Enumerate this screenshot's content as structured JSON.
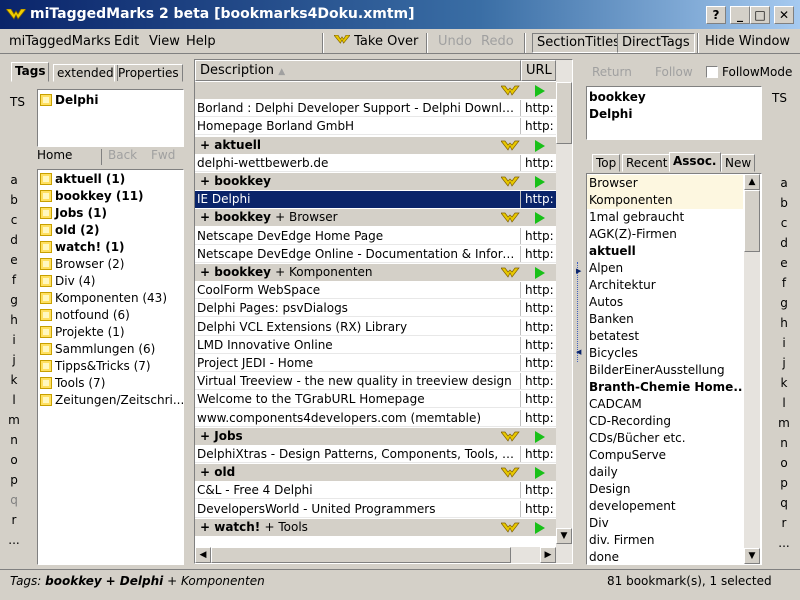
{
  "window": {
    "title": "miTaggedMarks 2 beta [bookmarks4Doku.xmtm]",
    "caption_buttons": [
      "?",
      "_",
      "□",
      "✕"
    ]
  },
  "menubar": {
    "items": [
      "miTaggedMarks",
      "Edit",
      "View",
      "Help"
    ],
    "take_over": "Take Over",
    "undo": "Undo",
    "redo": "Redo",
    "section_titles": "SectionTitles",
    "direct_tags": "DirectTags",
    "hide_window": "Hide Window"
  },
  "left": {
    "tabs": [
      "Tags",
      "extended",
      "Properties"
    ],
    "ts_label": "TS",
    "selected_tags": [
      "Delphi"
    ],
    "nav": {
      "home": "Home",
      "back": "Back",
      "fwd": "Fwd"
    },
    "letters": [
      "a",
      "b",
      "c",
      "d",
      "e",
      "f",
      "g",
      "h",
      "i",
      "j",
      "k",
      "l",
      "m",
      "n",
      "o",
      "p",
      "q",
      "r",
      "..."
    ],
    "tags": [
      {
        "label": "aktuell (1)",
        "bold": true
      },
      {
        "label": "bookkey (11)",
        "bold": true
      },
      {
        "label": "Jobs (1)",
        "bold": true
      },
      {
        "label": "old (2)",
        "bold": true
      },
      {
        "label": "watch! (1)",
        "bold": true
      },
      {
        "label": "Browser (2)",
        "bold": false
      },
      {
        "label": "Div (4)",
        "bold": false
      },
      {
        "label": "Komponenten (43)",
        "bold": false
      },
      {
        "label": "notfound (6)",
        "bold": false
      },
      {
        "label": "Projekte (1)",
        "bold": false
      },
      {
        "label": "Sammlungen (6)",
        "bold": false
      },
      {
        "label": "Tipps&Tricks (7)",
        "bold": false
      },
      {
        "label": "Tools (7)",
        "bold": false
      },
      {
        "label": "Zeitungen/Zeitschri...",
        "bold": false
      }
    ]
  },
  "grid": {
    "col_description": "Description",
    "col_url": "URL",
    "rows": [
      {
        "type": "group",
        "title": "",
        "sub": ""
      },
      {
        "type": "item",
        "desc": "Borland : Delphi Developer Support - Delphi Downloads",
        "url": "http:"
      },
      {
        "type": "item",
        "desc": "Homepage Borland GmbH",
        "url": "http:"
      },
      {
        "type": "group",
        "title": "+ aktuell",
        "sub": ""
      },
      {
        "type": "item",
        "desc": "delphi-wettbewerb.de",
        "url": "http:"
      },
      {
        "type": "group",
        "title": "+ bookkey",
        "sub": ""
      },
      {
        "type": "item",
        "desc": "IE Delphi",
        "url": "http:",
        "selected": true
      },
      {
        "type": "group",
        "title": "+ bookkey",
        "sub": "+ Browser"
      },
      {
        "type": "item",
        "desc": "Netscape DevEdge Home Page",
        "url": "http:"
      },
      {
        "type": "item",
        "desc": "Netscape DevEdge Online - Documentation & Informat...",
        "url": "http:"
      },
      {
        "type": "group",
        "title": "+ bookkey",
        "sub": "+ Komponenten"
      },
      {
        "type": "item",
        "desc": "CoolForm WebSpace",
        "url": "http:"
      },
      {
        "type": "item",
        "desc": "Delphi Pages: psvDialogs",
        "url": "http:"
      },
      {
        "type": "item",
        "desc": "Delphi VCL Extensions (RX) Library",
        "url": "http:"
      },
      {
        "type": "item",
        "desc": "LMD Innovative Online",
        "url": "http:"
      },
      {
        "type": "item",
        "desc": "Project JEDI - Home",
        "url": "http:"
      },
      {
        "type": "item",
        "desc": "Virtual Treeview - the new quality in treeview design",
        "url": "http:"
      },
      {
        "type": "item",
        "desc": "Welcome to the TGrabURL Homepage",
        "url": "http:"
      },
      {
        "type": "item",
        "desc": "www.components4developers.com (memtable)",
        "url": "http:"
      },
      {
        "type": "group",
        "title": "+ Jobs",
        "sub": ""
      },
      {
        "type": "item",
        "desc": "DelphiXtras - Design Patterns, Components, Tools, Ex...",
        "url": "http:"
      },
      {
        "type": "group",
        "title": "+ old",
        "sub": ""
      },
      {
        "type": "item",
        "desc": "C&L - Free 4 Delphi",
        "url": "http:"
      },
      {
        "type": "item",
        "desc": "DevelopersWorld - United Programmers",
        "url": "http:"
      },
      {
        "type": "group",
        "title": "+ watch!",
        "sub": "+ Tools"
      }
    ]
  },
  "right": {
    "return": "Return",
    "follow": "Follow",
    "follow_mode": "FollowMode",
    "ts_label": "TS",
    "current_tags": [
      "bookkey",
      "Delphi"
    ],
    "tabs": [
      "Top",
      "Recent",
      "Assoc.",
      "New"
    ],
    "assoc": [
      {
        "label": "Browser",
        "bold": false
      },
      {
        "label": "Komponenten",
        "bold": false
      },
      {
        "label": "1mal gebraucht",
        "bold": false
      },
      {
        "label": "AGK(Z)-Firmen",
        "bold": false
      },
      {
        "label": "aktuell",
        "bold": true
      },
      {
        "label": "Alpen",
        "bold": false
      },
      {
        "label": "Architektur",
        "bold": false
      },
      {
        "label": "Autos",
        "bold": false
      },
      {
        "label": "Banken",
        "bold": false
      },
      {
        "label": "betatest",
        "bold": false
      },
      {
        "label": "Bicycles",
        "bold": false
      },
      {
        "label": "BilderEinerAusstellung",
        "bold": false
      },
      {
        "label": "Branth-Chemie Home...",
        "bold": true
      },
      {
        "label": "CADCAM",
        "bold": false
      },
      {
        "label": "CD-Recording",
        "bold": false
      },
      {
        "label": "CDs/Bücher etc.",
        "bold": false
      },
      {
        "label": "CompuServe",
        "bold": false
      },
      {
        "label": "daily",
        "bold": false
      },
      {
        "label": "Design",
        "bold": false
      },
      {
        "label": "developement",
        "bold": false
      },
      {
        "label": "Div",
        "bold": false
      },
      {
        "label": "div. Firmen",
        "bold": false
      },
      {
        "label": "done",
        "bold": false
      }
    ],
    "letters": [
      "a",
      "b",
      "c",
      "d",
      "e",
      "f",
      "g",
      "h",
      "i",
      "j",
      "k",
      "l",
      "m",
      "n",
      "o",
      "p",
      "q",
      "r",
      "..."
    ]
  },
  "status": {
    "prefix": "Tags:",
    "tag1": "bookkey",
    "mid": "+ Delphi",
    "tail": "+ Komponenten",
    "count": "81 bookmark(s), 1 selected"
  }
}
